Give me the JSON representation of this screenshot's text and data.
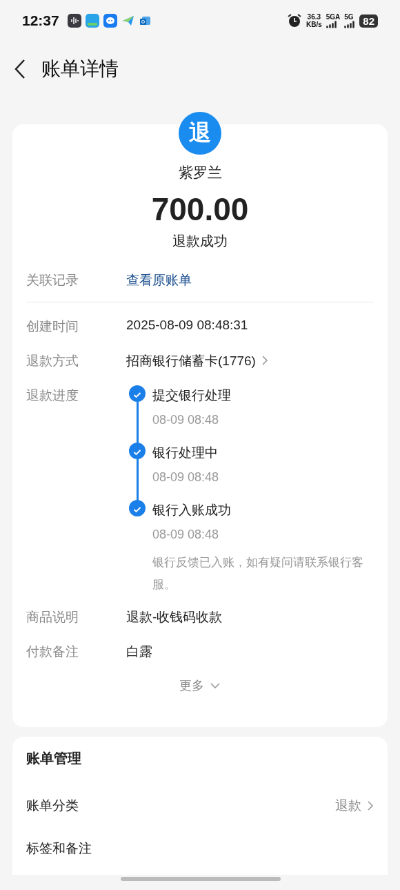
{
  "status_bar": {
    "time": "12:37",
    "speed": "36.3",
    "speed_unit": "KB/s",
    "network_1": "5GA",
    "network_2": "5G",
    "battery": "82"
  },
  "header": {
    "title": "账单详情"
  },
  "bill": {
    "icon_text": "退",
    "payee": "紫罗兰",
    "amount": "700.00",
    "status": "退款成功",
    "rows": [
      {
        "kind": "link",
        "label": "关联记录",
        "value": "查看原账单"
      },
      {
        "kind": "divider"
      },
      {
        "kind": "text",
        "label": "创建时间",
        "value": "2025-08-09 08:48:31"
      },
      {
        "kind": "chevron",
        "label": "退款方式",
        "value": "招商银行储蓄卡(1776)"
      },
      {
        "kind": "progress",
        "label": "退款进度",
        "steps": [
          {
            "title": "提交银行处理",
            "time": "08-09 08:48",
            "done": true
          },
          {
            "title": "银行处理中",
            "time": "08-09 08:48",
            "done": true
          },
          {
            "title": "银行入账成功",
            "time": "08-09 08:48",
            "done": true
          }
        ],
        "note": "银行反馈已入账，如有疑问请联系银行客服。"
      },
      {
        "kind": "text",
        "label": "商品说明",
        "value": "退款-收钱码收款"
      },
      {
        "kind": "text",
        "label": "付款备注",
        "value": "白露"
      }
    ],
    "more": "更多"
  },
  "management": {
    "title": "账单管理",
    "rows": [
      {
        "label": "账单分类",
        "value": "退款"
      },
      {
        "label": "标签和备注"
      }
    ]
  }
}
